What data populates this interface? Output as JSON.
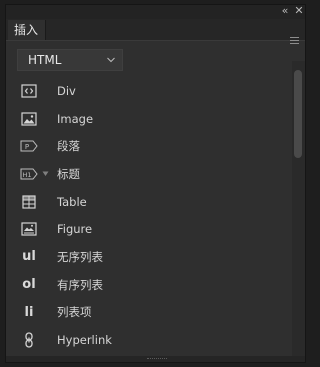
{
  "window": {
    "collapse_glyph": "«",
    "close_glyph": "✕"
  },
  "panel": {
    "tab_label": "插入"
  },
  "category": {
    "selected": "HTML"
  },
  "items": [
    {
      "label": "Div",
      "icon": "div-tag-icon"
    },
    {
      "label": "Image",
      "icon": "image-icon"
    },
    {
      "label": "段落",
      "icon": "paragraph-icon"
    },
    {
      "label": "标题",
      "icon": "heading-icon",
      "glyph_text": "H1"
    },
    {
      "label": "Table",
      "icon": "table-icon"
    },
    {
      "label": "Figure",
      "icon": "figure-icon"
    },
    {
      "label": "无序列表",
      "icon": "unordered-list-icon",
      "glyph_text": "ul"
    },
    {
      "label": "有序列表",
      "icon": "ordered-list-icon",
      "glyph_text": "ol"
    },
    {
      "label": "列表项",
      "icon": "list-item-icon",
      "glyph_text": "li"
    },
    {
      "label": "Hyperlink",
      "icon": "link-icon"
    }
  ],
  "colors": {
    "background": "#1e1e1e",
    "panel": "#2f2f2f",
    "text": "#d6d6d6",
    "scroll_thumb": "#4a4a4a"
  }
}
